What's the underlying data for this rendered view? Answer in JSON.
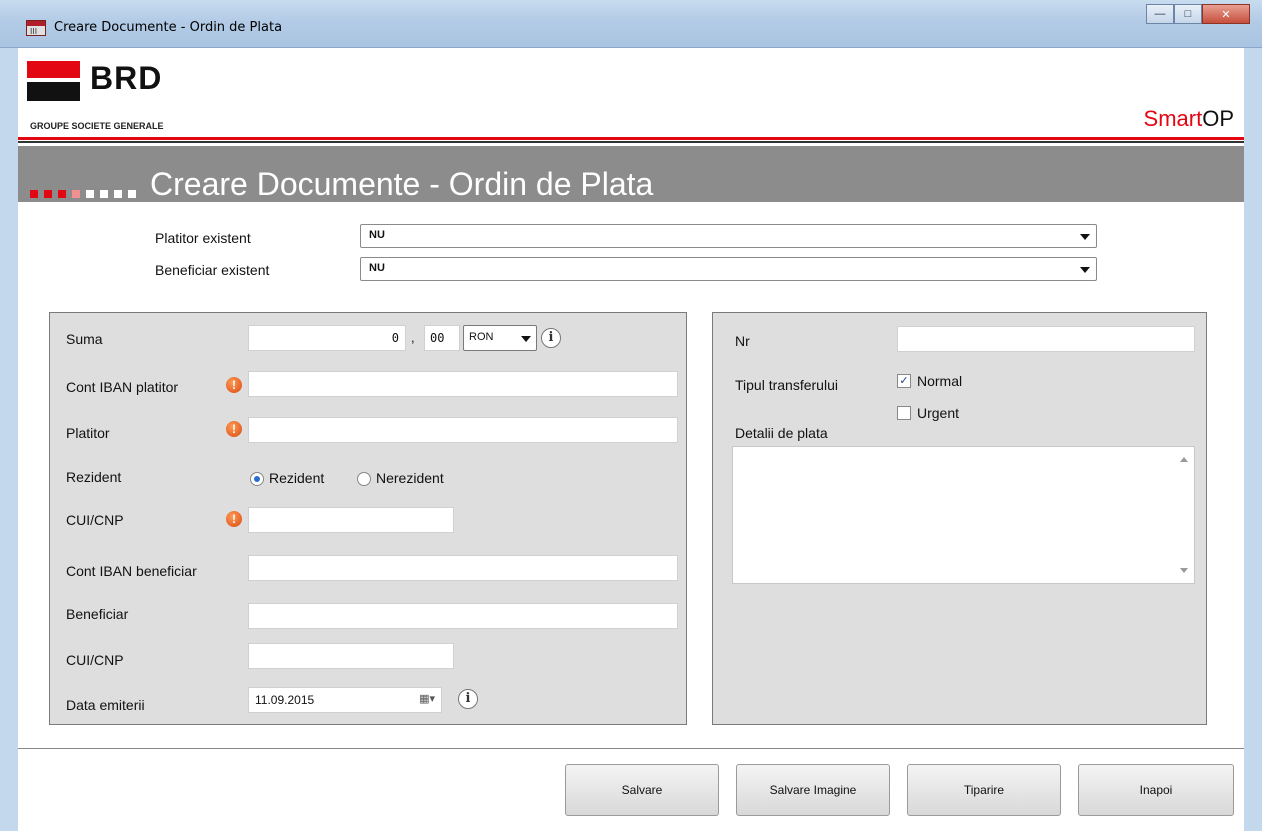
{
  "window": {
    "title": "Creare Documente - Ordin de Plata",
    "icon_text": "III"
  },
  "header": {
    "brand": "BRD",
    "brand_sub": "GROUPE SOCIETE GENERALE",
    "product_part1": "Smart",
    "product_part2": "OP",
    "brand_color": "#e30613"
  },
  "banner": {
    "title": "Creare Documente - Ordin de Plata"
  },
  "selects": {
    "platitor_label": "Platitor existent",
    "platitor_value": "NU",
    "beneficiar_label": "Beneficiar existent",
    "beneficiar_value": "NU"
  },
  "left": {
    "suma_label": "Suma",
    "suma_int": "0",
    "suma_sep": ",",
    "suma_dec": "00",
    "currency": "RON",
    "cont_iban_platitor_label": "Cont IBAN platitor",
    "platitor_label": "Platitor",
    "rezident_label": "Rezident",
    "rezident_option1": "Rezident",
    "rezident_option2": "Nerezident",
    "cui_label": "CUI/CNP",
    "cont_iban_beneficiar_label": "Cont IBAN beneficiar",
    "beneficiar_label": "Beneficiar",
    "cui2_label": "CUI/CNP",
    "data_label": "Data emiterii",
    "data_value": "11.09.2015"
  },
  "right": {
    "nr_label": "Nr",
    "tip_label": "Tipul transferului",
    "normal_label": "Normal",
    "normal_checked": true,
    "urgent_label": "Urgent",
    "urgent_checked": false,
    "detalii_label": "Detalii de plata"
  },
  "buttons": {
    "salvare": "Salvare",
    "salvare_imagine": "Salvare Imagine",
    "tiparire": "Tiparire",
    "inapoi": "Inapoi"
  },
  "icons": {
    "warning": "warning-icon",
    "info": "info-icon",
    "calendar": "calendar-icon"
  }
}
